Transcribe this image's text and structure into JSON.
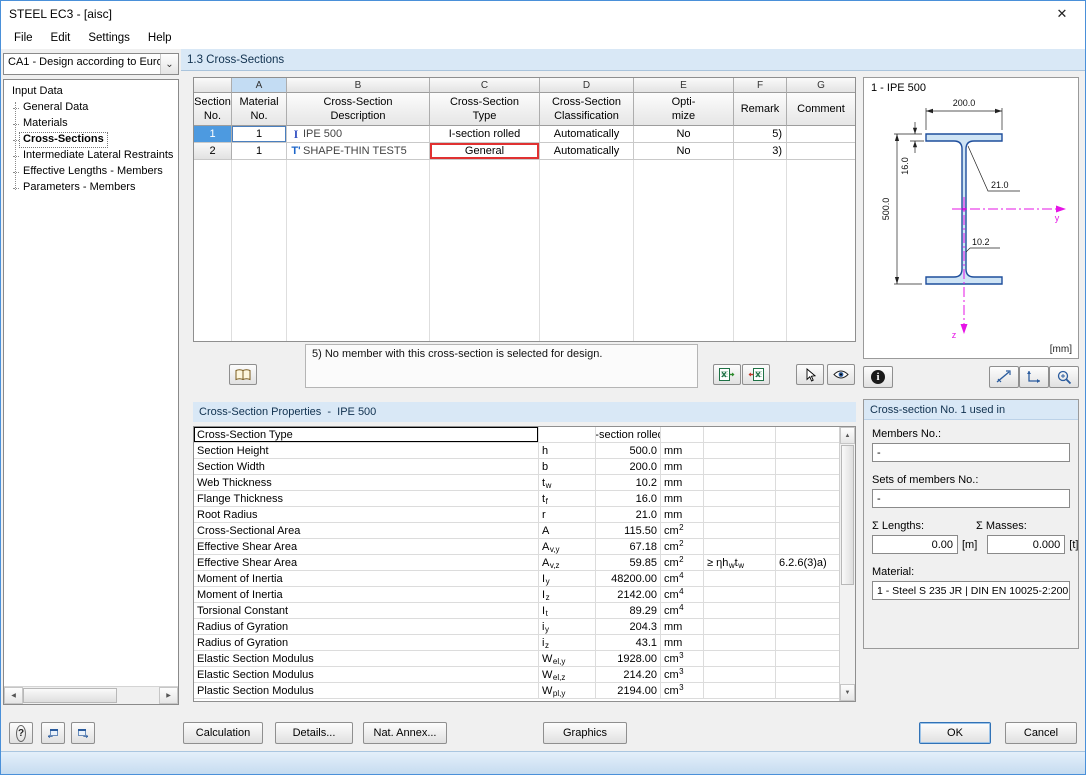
{
  "window": {
    "title": "STEEL EC3 - [aisc]"
  },
  "icons": {
    "close": "✕",
    "combo_chevron": "⌄",
    "scroll_left": "◀",
    "scroll_right": "▶",
    "scroll_up": "▲",
    "scroll_down": "▼",
    "info": "i",
    "help": "?"
  },
  "menu": {
    "items": [
      "File",
      "Edit",
      "Settings",
      "Help"
    ]
  },
  "left_panel": {
    "case_selector": {
      "value": "CA1 - Design according to Euro"
    },
    "tree": {
      "root": "Input Data",
      "items": [
        {
          "label": "General Data",
          "selected": false
        },
        {
          "label": "Materials",
          "selected": false
        },
        {
          "label": "Cross-Sections",
          "selected": true
        },
        {
          "label": "Intermediate Lateral Restraints",
          "selected": false
        },
        {
          "label": "Effective Lengths - Members",
          "selected": false
        },
        {
          "label": "Parameters - Members",
          "selected": false
        }
      ]
    }
  },
  "section_header": {
    "title": "1.3 Cross-Sections"
  },
  "cross_section_table": {
    "column_letters": [
      "",
      "A",
      "B",
      "C",
      "D",
      "E",
      "F",
      "G"
    ],
    "headers": [
      "Section\nNo.",
      "Material\nNo.",
      "Cross-Section\nDescription",
      "Cross-Section\nType",
      "Cross-Section\nClassification",
      "Opti-\nmize",
      "Remark",
      "Comment"
    ],
    "rows": [
      {
        "section_no": "1",
        "material_no": "1",
        "icon": "I",
        "description": "IPE 500",
        "type": "I-section rolled",
        "classification": "Automatically",
        "optimize": "No",
        "remark": "5)",
        "comment": "",
        "row_selected": true,
        "type_marked": false
      },
      {
        "section_no": "2",
        "material_no": "1",
        "icon": "T",
        "description": "SHAPE-THIN TEST5",
        "type": "General",
        "classification": "Automatically",
        "optimize": "No",
        "remark": "3)",
        "comment": "",
        "row_selected": false,
        "type_marked": true
      }
    ],
    "footnote": "5) No member with this cross-section is selected for design."
  },
  "properties_panel": {
    "title": "Cross-Section Properties  -  IPE 500",
    "rows": [
      {
        "name": "Cross-Section Type",
        "sym": {
          "b": "",
          "s": ""
        },
        "value": "I-section rolled",
        "unit": {
          "b": "",
          "s": ""
        },
        "cond": [],
        "ref": "",
        "text_value": true,
        "focused": true
      },
      {
        "name": "Section Height",
        "sym": {
          "b": "h",
          "s": ""
        },
        "value": "500.0",
        "unit": {
          "b": "mm",
          "s": ""
        },
        "cond": [],
        "ref": ""
      },
      {
        "name": "Section Width",
        "sym": {
          "b": "b",
          "s": ""
        },
        "value": "200.0",
        "unit": {
          "b": "mm",
          "s": ""
        },
        "cond": [],
        "ref": ""
      },
      {
        "name": "Web Thickness",
        "sym": {
          "b": "t",
          "s": "w"
        },
        "value": "10.2",
        "unit": {
          "b": "mm",
          "s": ""
        },
        "cond": [],
        "ref": ""
      },
      {
        "name": "Flange Thickness",
        "sym": {
          "b": "t",
          "s": "f"
        },
        "value": "16.0",
        "unit": {
          "b": "mm",
          "s": ""
        },
        "cond": [],
        "ref": ""
      },
      {
        "name": "Root Radius",
        "sym": {
          "b": "r",
          "s": ""
        },
        "value": "21.0",
        "unit": {
          "b": "mm",
          "s": ""
        },
        "cond": [],
        "ref": ""
      },
      {
        "name": "Cross-Sectional Area",
        "sym": {
          "b": "A",
          "s": ""
        },
        "value": "115.50",
        "unit": {
          "b": "cm",
          "s": "2"
        },
        "cond": [],
        "ref": ""
      },
      {
        "name": "Effective Shear Area",
        "sym": {
          "b": "A",
          "s": "v,y"
        },
        "value": "67.18",
        "unit": {
          "b": "cm",
          "s": "2"
        },
        "cond": [],
        "ref": ""
      },
      {
        "name": "Effective Shear Area",
        "sym": {
          "b": "A",
          "s": "v,z"
        },
        "value": "59.85",
        "unit": {
          "b": "cm",
          "s": "2"
        },
        "cond": [
          {
            "b": "≥ ηh",
            "s": "w"
          },
          {
            "b": "t",
            "s": "w"
          }
        ],
        "ref": "6.2.6(3)a)"
      },
      {
        "name": "Moment of Inertia",
        "sym": {
          "b": "I",
          "s": "y"
        },
        "value": "48200.00",
        "unit": {
          "b": "cm",
          "s": "4"
        },
        "cond": [],
        "ref": ""
      },
      {
        "name": "Moment of Inertia",
        "sym": {
          "b": "I",
          "s": "z"
        },
        "value": "2142.00",
        "unit": {
          "b": "cm",
          "s": "4"
        },
        "cond": [],
        "ref": ""
      },
      {
        "name": "Torsional Constant",
        "sym": {
          "b": "I",
          "s": "t"
        },
        "value": "89.29",
        "unit": {
          "b": "cm",
          "s": "4"
        },
        "cond": [],
        "ref": ""
      },
      {
        "name": "Radius of Gyration",
        "sym": {
          "b": "i",
          "s": "y"
        },
        "value": "204.3",
        "unit": {
          "b": "mm",
          "s": ""
        },
        "cond": [],
        "ref": ""
      },
      {
        "name": "Radius of Gyration",
        "sym": {
          "b": "i",
          "s": "z"
        },
        "value": "43.1",
        "unit": {
          "b": "mm",
          "s": ""
        },
        "cond": [],
        "ref": ""
      },
      {
        "name": "Elastic Section Modulus",
        "sym": {
          "b": "W",
          "s": "el,y"
        },
        "value": "1928.00",
        "unit": {
          "b": "cm",
          "s": "3"
        },
        "cond": [],
        "ref": ""
      },
      {
        "name": "Elastic Section Modulus",
        "sym": {
          "b": "W",
          "s": "el,z"
        },
        "value": "214.20",
        "unit": {
          "b": "cm",
          "s": "3"
        },
        "cond": [],
        "ref": ""
      },
      {
        "name": "Plastic Section Modulus",
        "sym": {
          "b": "W",
          "s": "pl,y"
        },
        "value": "2194.00",
        "unit": {
          "b": "cm",
          "s": "3"
        },
        "cond": [],
        "ref": ""
      }
    ]
  },
  "drawing": {
    "title": "1 - IPE 500",
    "unit_label": "[mm]",
    "dims": {
      "width": "200.0",
      "flange_thickness": "16.0",
      "root_radius": "21.0",
      "height": "500.0",
      "web_thickness": "10.2"
    },
    "axes": {
      "horizontal": "y",
      "vertical": "z"
    },
    "colors": {
      "section_fill": "#cfe4f5",
      "section_stroke": "#1f4e9c",
      "axis": "#e614e6"
    }
  },
  "used_in": {
    "title": "Cross-section No. 1 used in",
    "members_label": "Members No.:",
    "members_value": "-",
    "sets_label": "Sets of members No.:",
    "sets_value": "-",
    "lengths_label": "Σ Lengths:",
    "lengths_value": "0.00",
    "lengths_unit": "[m]",
    "masses_label": "Σ Masses:",
    "masses_value": "0.000",
    "masses_unit": "[t]",
    "material_label": "Material:",
    "material_value": "1 - Steel S 235 JR | DIN EN 10025-2:200"
  },
  "footer": {
    "calculation": "Calculation",
    "details": "Details...",
    "nat_annex": "Nat. Annex...",
    "graphics": "Graphics",
    "ok": "OK",
    "cancel": "Cancel"
  }
}
